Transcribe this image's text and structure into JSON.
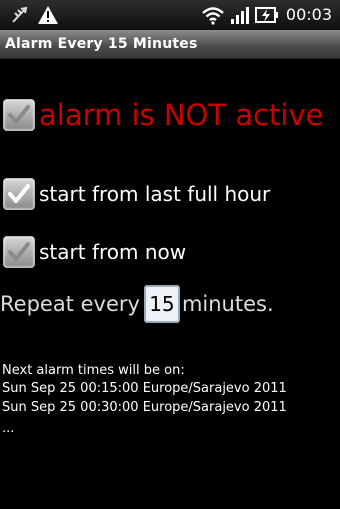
{
  "status_bar": {
    "time": "00:03",
    "icons": [
      "usb-debug-icon",
      "warning-icon",
      "wifi-icon",
      "signal-icon",
      "battery-charging-icon"
    ]
  },
  "app": {
    "title": "Alarm Every 15 Minutes"
  },
  "alarm_toggle": {
    "label": "alarm is NOT active",
    "checked": true,
    "label_color": "#cc0000"
  },
  "options": [
    {
      "label": "start from last full hour",
      "checked": true
    },
    {
      "label": "start from now",
      "checked": true
    }
  ],
  "repeat": {
    "prefix": "Repeat every",
    "value": "15",
    "suffix": "minutes."
  },
  "next_alarms": {
    "title": "Next alarm times will be on:",
    "times": [
      "Sun Sep 25 00:15:00 Europe/Sarajevo 2011",
      "Sun Sep 25 00:30:00 Europe/Sarajevo 2011"
    ],
    "more": "..."
  }
}
